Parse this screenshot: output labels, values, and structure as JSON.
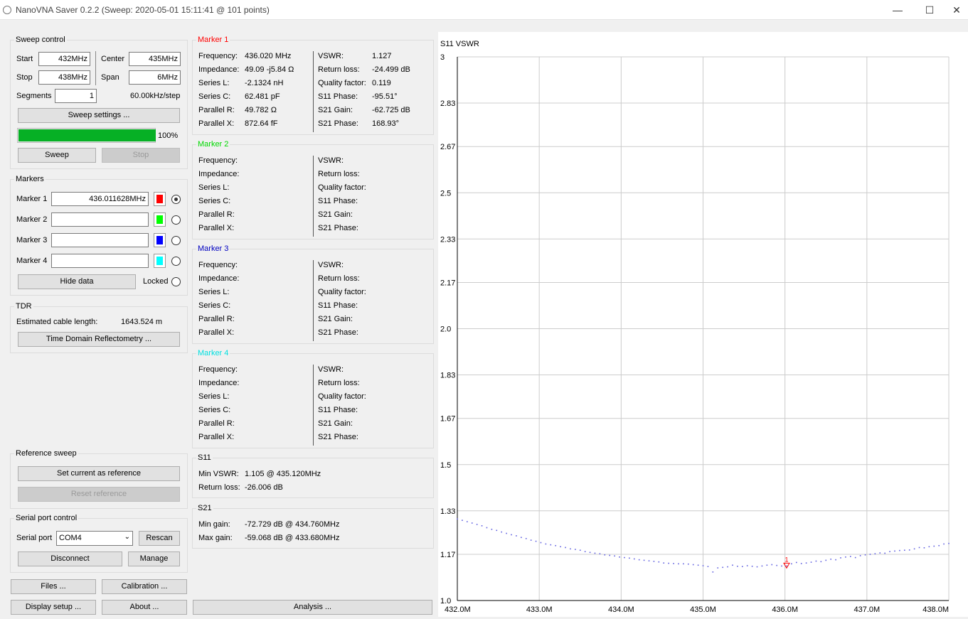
{
  "window": {
    "title": "NanoVNA Saver 0.2.2 (Sweep: 2020-05-01 15:11:41 @ 101 points)",
    "minimize": "—",
    "maximize": "☐",
    "close": "✕"
  },
  "sweep": {
    "group_title": "Sweep control",
    "start_label": "Start",
    "start_value": "432MHz",
    "center_label": "Center",
    "center_value": "435MHz",
    "stop_label": "Stop",
    "stop_value": "438MHz",
    "span_label": "Span",
    "span_value": "6MHz",
    "segments_label": "Segments",
    "segments_value": "1",
    "step_text": "60.00kHz/step",
    "settings_button": "Sweep settings ...",
    "progress": 1.0,
    "progress_text": "100%",
    "sweep_button": "Sweep",
    "stop_button": "Stop"
  },
  "markers_panel": {
    "group_title": "Markers",
    "items": [
      {
        "label": "Marker 1",
        "value": "436.011628MHz",
        "color": "#ff0000",
        "selected": true
      },
      {
        "label": "Marker 2",
        "value": "",
        "color": "#00ff00",
        "selected": false
      },
      {
        "label": "Marker 3",
        "value": "",
        "color": "#0000ff",
        "selected": false
      },
      {
        "label": "Marker 4",
        "value": "",
        "color": "#00ffff",
        "selected": false
      }
    ],
    "hide_button": "Hide data",
    "locked_label": "Locked"
  },
  "tdr": {
    "group_title": "TDR",
    "cable_label": "Estimated cable length:",
    "cable_value": "1643.524 m",
    "tdr_button": "Time Domain Reflectometry ..."
  },
  "reference": {
    "group_title": "Reference sweep",
    "set_button": "Set current as reference",
    "reset_button": "Reset reference"
  },
  "serial": {
    "group_title": "Serial port control",
    "port_label": "Serial port",
    "port_value": "COM4",
    "rescan_button": "Rescan",
    "disconnect_button": "Disconnect",
    "manage_button": "Manage"
  },
  "bottom_buttons": {
    "files": "Files ...",
    "calibration": "Calibration ...",
    "display": "Display setup ...",
    "about": "About ...",
    "analysis": "Analysis ..."
  },
  "marker_details": [
    {
      "title": "Marker 1",
      "color": "#ff0000",
      "left": [
        {
          "label": "Frequency:",
          "value": "436.020 MHz"
        },
        {
          "label": "Impedance:",
          "value": "49.09 -j5.84 Ω"
        },
        {
          "label": "Series L:",
          "value": "-2.1324 nH"
        },
        {
          "label": "Series C:",
          "value": "62.481 pF"
        },
        {
          "label": "Parallel R:",
          "value": "49.782 Ω"
        },
        {
          "label": "Parallel X:",
          "value": "872.64 fF"
        }
      ],
      "right": [
        {
          "label": "VSWR:",
          "value": "1.127"
        },
        {
          "label": "Return loss:",
          "value": "-24.499 dB"
        },
        {
          "label": "Quality factor:",
          "value": "0.119"
        },
        {
          "label": "S11 Phase:",
          "value": "-95.51°"
        },
        {
          "label": "S21 Gain:",
          "value": "-62.725 dB"
        },
        {
          "label": "S21 Phase:",
          "value": "168.93°"
        }
      ]
    },
    {
      "title": "Marker 2",
      "color": "#00d800",
      "left": [
        {
          "label": "Frequency:",
          "value": ""
        },
        {
          "label": "Impedance:",
          "value": ""
        },
        {
          "label": "Series L:",
          "value": ""
        },
        {
          "label": "Series C:",
          "value": ""
        },
        {
          "label": "Parallel R:",
          "value": ""
        },
        {
          "label": "Parallel X:",
          "value": ""
        }
      ],
      "right": [
        {
          "label": "VSWR:",
          "value": ""
        },
        {
          "label": "Return loss:",
          "value": ""
        },
        {
          "label": "Quality factor:",
          "value": ""
        },
        {
          "label": "S11 Phase:",
          "value": ""
        },
        {
          "label": "S21 Gain:",
          "value": ""
        },
        {
          "label": "S21 Phase:",
          "value": ""
        }
      ]
    },
    {
      "title": "Marker 3",
      "color": "#0000c0",
      "left": [
        {
          "label": "Frequency:",
          "value": ""
        },
        {
          "label": "Impedance:",
          "value": ""
        },
        {
          "label": "Series L:",
          "value": ""
        },
        {
          "label": "Series C:",
          "value": ""
        },
        {
          "label": "Parallel R:",
          "value": ""
        },
        {
          "label": "Parallel X:",
          "value": ""
        }
      ],
      "right": [
        {
          "label": "VSWR:",
          "value": ""
        },
        {
          "label": "Return loss:",
          "value": ""
        },
        {
          "label": "Quality factor:",
          "value": ""
        },
        {
          "label": "S11 Phase:",
          "value": ""
        },
        {
          "label": "S21 Gain:",
          "value": ""
        },
        {
          "label": "S21 Phase:",
          "value": ""
        }
      ]
    },
    {
      "title": "Marker 4",
      "color": "#00e0e0",
      "left": [
        {
          "label": "Frequency:",
          "value": ""
        },
        {
          "label": "Impedance:",
          "value": ""
        },
        {
          "label": "Series L:",
          "value": ""
        },
        {
          "label": "Series C:",
          "value": ""
        },
        {
          "label": "Parallel R:",
          "value": ""
        },
        {
          "label": "Parallel X:",
          "value": ""
        }
      ],
      "right": [
        {
          "label": "VSWR:",
          "value": ""
        },
        {
          "label": "Return loss:",
          "value": ""
        },
        {
          "label": "Quality factor:",
          "value": ""
        },
        {
          "label": "S11 Phase:",
          "value": ""
        },
        {
          "label": "S21 Gain:",
          "value": ""
        },
        {
          "label": "S21 Phase:",
          "value": ""
        }
      ]
    }
  ],
  "s11_summary": {
    "group_title": "S11",
    "min_vswr_label": "Min VSWR:",
    "min_vswr_value": "1.105 @ 435.120MHz",
    "return_loss_label": "Return loss:",
    "return_loss_value": "-26.006 dB"
  },
  "s21_summary": {
    "group_title": "S21",
    "min_gain_label": "Min gain:",
    "min_gain_value": "-72.729 dB @ 434.760MHz",
    "max_gain_label": "Max gain:",
    "max_gain_value": "-59.068 dB @ 433.680MHz"
  },
  "chart_data": {
    "type": "scatter",
    "title": "S11 VSWR",
    "x_unit": "MHz",
    "xlim": [
      432.0,
      438.0
    ],
    "ylim": [
      1.0,
      3.0
    ],
    "x_ticks": [
      432.0,
      433.0,
      434.0,
      435.0,
      436.0,
      437.0,
      438.0
    ],
    "x_tick_labels": [
      "432.0M",
      "433.0M",
      "434.0M",
      "435.0M",
      "436.0M",
      "437.0M",
      "438.0M"
    ],
    "y_ticks": [
      1.0,
      1.17,
      1.33,
      1.5,
      1.67,
      1.83,
      2.0,
      2.17,
      2.33,
      2.5,
      2.67,
      2.83,
      3.0
    ],
    "y_tick_labels": [
      "1.0",
      "1.17",
      "1.33",
      "1.5",
      "1.67",
      "1.83",
      "2.0",
      "2.17",
      "2.33",
      "2.5",
      "2.67",
      "2.83",
      "3"
    ],
    "grid": true,
    "series_color": "#6060e0",
    "series": [
      {
        "x": [
          432.0,
          432.06,
          432.12,
          432.18,
          432.24,
          432.3,
          432.36,
          432.42,
          432.48,
          432.54,
          432.6,
          432.66,
          432.72,
          432.78,
          432.84,
          432.9,
          432.96,
          433.02,
          433.08,
          433.14,
          433.2,
          433.26,
          433.32,
          433.38,
          433.44,
          433.5,
          433.56,
          433.62,
          433.68,
          433.74,
          433.8,
          433.86,
          433.92,
          433.98,
          434.04,
          434.1,
          434.16,
          434.22,
          434.28,
          434.34,
          434.4,
          434.46,
          434.52,
          434.58,
          434.64,
          434.7,
          434.76,
          434.82,
          434.88,
          434.94,
          435.0,
          435.06,
          435.12,
          435.18,
          435.24,
          435.3,
          435.36,
          435.42,
          435.48,
          435.54,
          435.6,
          435.66,
          435.72,
          435.78,
          435.84,
          435.9,
          435.96,
          436.02,
          436.08,
          436.14,
          436.2,
          436.26,
          436.32,
          436.38,
          436.44,
          436.5,
          436.56,
          436.62,
          436.68,
          436.74,
          436.8,
          436.86,
          436.92,
          436.98,
          437.04,
          437.1,
          437.16,
          437.22,
          437.28,
          437.34,
          437.4,
          437.46,
          437.52,
          437.58,
          437.64,
          437.7,
          437.76,
          437.82,
          437.88,
          437.94,
          438.0
        ],
        "values": [
          1.3,
          1.295,
          1.29,
          1.285,
          1.28,
          1.275,
          1.268,
          1.262,
          1.258,
          1.252,
          1.247,
          1.242,
          1.238,
          1.232,
          1.228,
          1.222,
          1.218,
          1.213,
          1.208,
          1.205,
          1.202,
          1.198,
          1.195,
          1.19,
          1.188,
          1.185,
          1.18,
          1.177,
          1.174,
          1.172,
          1.168,
          1.166,
          1.164,
          1.16,
          1.158,
          1.156,
          1.153,
          1.15,
          1.148,
          1.146,
          1.144,
          1.142,
          1.138,
          1.137,
          1.136,
          1.135,
          1.135,
          1.134,
          1.132,
          1.13,
          1.128,
          1.125,
          1.105,
          1.12,
          1.122,
          1.124,
          1.13,
          1.126,
          1.125,
          1.128,
          1.126,
          1.124,
          1.127,
          1.13,
          1.132,
          1.129,
          1.127,
          1.127,
          1.135,
          1.14,
          1.136,
          1.138,
          1.141,
          1.145,
          1.143,
          1.148,
          1.152,
          1.15,
          1.157,
          1.16,
          1.162,
          1.158,
          1.165,
          1.168,
          1.17,
          1.172,
          1.175,
          1.174,
          1.18,
          1.182,
          1.184,
          1.185,
          1.186,
          1.19,
          1.195,
          1.194,
          1.198,
          1.2,
          1.202,
          1.208,
          1.21
        ]
      }
    ],
    "marker": {
      "label": "1",
      "x": 436.02,
      "y": 1.127,
      "color": "#ff0000"
    }
  }
}
